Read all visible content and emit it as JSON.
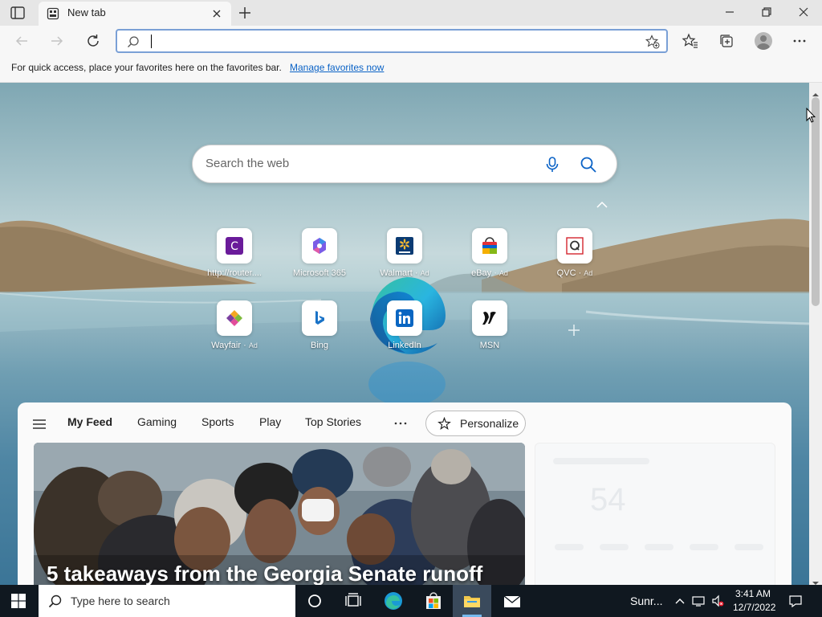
{
  "tab": {
    "title": "New tab"
  },
  "favorites_bar": {
    "hint": "For quick access, place your favorites here on the favorites bar.",
    "link": "Manage favorites now"
  },
  "newtab": {
    "search_placeholder": "Search the web",
    "tiles": [
      {
        "label": "http://router....",
        "ad": "",
        "icon": "c-letter-icon"
      },
      {
        "label": "Microsoft 365",
        "ad": "",
        "icon": "microsoft-365-icon"
      },
      {
        "label": "Walmart",
        "ad": "Ad",
        "icon": "walmart-icon"
      },
      {
        "label": "eBay",
        "ad": "Ad",
        "icon": "ebay-icon"
      },
      {
        "label": "QVC",
        "ad": "Ad",
        "icon": "qvc-icon"
      },
      {
        "label": "Wayfair",
        "ad": "Ad",
        "icon": "wayfair-icon"
      },
      {
        "label": "Bing",
        "ad": "",
        "icon": "bing-icon"
      },
      {
        "label": "LinkedIn",
        "ad": "",
        "icon": "linkedin-icon"
      },
      {
        "label": "MSN",
        "ad": "",
        "icon": "msn-icon"
      }
    ]
  },
  "feed": {
    "tabs": [
      "My Feed",
      "Gaming",
      "Sports",
      "Play",
      "Top Stories"
    ],
    "personalize": "Personalize",
    "headline": "5 takeaways from the Georgia Senate runoff",
    "weather_temp": "54"
  },
  "taskbar": {
    "search_placeholder": "Type here to search",
    "tray_weather": "Sunr...",
    "time": "3:41 AM",
    "date": "12/7/2022"
  },
  "colors": {
    "accent": "#0a62c6",
    "taskbar": "#101820",
    "address_focus": "#7aa0d6"
  }
}
